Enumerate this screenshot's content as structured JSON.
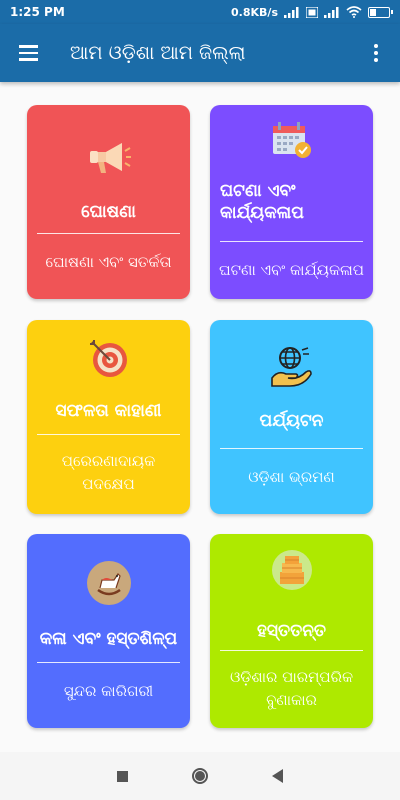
{
  "status": {
    "time": "1:25 PM",
    "network_speed": "0.8KB/s",
    "signal_label": "Vo LTE"
  },
  "app_bar": {
    "title": "ଆମ ଓଡ଼ିଶା ଆମ ଜିଲ୍ଲା"
  },
  "cards": [
    {
      "heading": "ଘୋଷଣା",
      "subtitle": "ଘୋଷଣା ଏବଂ ସତର୍କତା",
      "color": "#f05456",
      "icon": "megaphone-icon"
    },
    {
      "heading": "ଘଟଣା ଏବଂ କାର୍ଯ୍ୟକଳାପ",
      "subtitle": "ଘଟଣା ଏବଂ କାର୍ଯ୍ୟକଳାପ",
      "color": "#7c4dff",
      "icon": "calendar-icon"
    },
    {
      "heading": "ସଫଳତା କାହାଣୀ",
      "subtitle": "ପ୍ରେରଣାଦାୟକ ପଦକ୍ଷେପ",
      "color": "#fdd00f",
      "icon": "target-icon"
    },
    {
      "heading": "ପର୍ଯ୍ୟଟନ",
      "subtitle": "ଓଡ଼ିଶା ଭ୍ରମଣ",
      "color": "#40c4ff",
      "icon": "globe-hand-icon"
    },
    {
      "heading": "କଳା ଏବଂ ହସ୍ତଶିଳ୍ପ",
      "subtitle": "ସୁନ୍ଦର କାରିଗରୀ",
      "color": "#536dfe",
      "icon": "rocking-horse-icon"
    },
    {
      "heading": "ହସ୍ତତନ୍ତ",
      "subtitle": "ଓଡ଼ିଶାର ପାରମ୍ପରିକ ବୁଣାକାର",
      "color": "#aee900",
      "icon": "fabric-bundle-icon"
    }
  ]
}
